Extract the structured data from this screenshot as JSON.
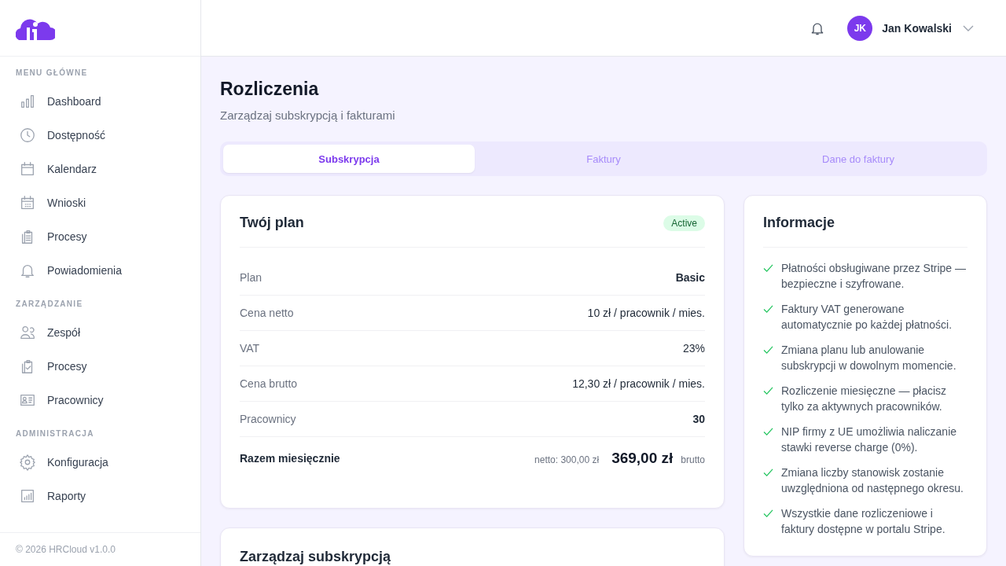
{
  "sidebar": {
    "sections": [
      {
        "title": "MENU GŁÓWNE",
        "items": [
          {
            "label": "Dashboard",
            "selected": false
          },
          {
            "label": "Dostępność",
            "selected": false
          },
          {
            "label": "Kalendarz",
            "selected": false
          },
          {
            "label": "Wnioski",
            "selected": false
          },
          {
            "label": "Procesy",
            "selected": false
          },
          {
            "label": "Powiadomienia",
            "selected": false
          }
        ]
      },
      {
        "title": "ZARZĄDZANIE",
        "items": [
          {
            "label": "Zespół",
            "selected": false
          },
          {
            "label": "Procesy",
            "selected": false
          },
          {
            "label": "Pracownicy",
            "selected": false
          }
        ]
      },
      {
        "title": "ADMINISTRACJA",
        "items": [
          {
            "label": "Konfiguracja",
            "selected": false
          },
          {
            "label": "Raporty",
            "selected": false
          }
        ]
      }
    ],
    "footer": "© 2026 HRCloud v1.0.0"
  },
  "header": {
    "user": {
      "initials": "JK",
      "name": "Jan Kowalski"
    }
  },
  "page": {
    "title": "Rozliczenia",
    "subtitle": "Zarządzaj subskrypcją i fakturami"
  },
  "tabs": [
    {
      "label": "Subskrypcja",
      "selected": true
    },
    {
      "label": "Faktury",
      "selected": false
    },
    {
      "label": "Dane do faktury",
      "selected": false
    }
  ],
  "plan_card": {
    "title": "Twój plan",
    "status": "Active",
    "rows": [
      {
        "label": "Plan",
        "value": "Basic",
        "emphasis": true
      },
      {
        "label": "Cena netto",
        "value": "10 zł / pracownik / mies.",
        "emphasis": false
      },
      {
        "label": "VAT",
        "value": "23%",
        "emphasis": false
      },
      {
        "label": "Cena brutto",
        "value": "12,30 zł / pracownik / mies.",
        "emphasis": false
      },
      {
        "label": "Pracownicy",
        "value": "30",
        "emphasis": true
      }
    ],
    "total": {
      "label": "Razem miesięcznie",
      "net": "netto: 300,00 zł",
      "amount": "369,00 zł",
      "suffix": "brutto"
    }
  },
  "manage_card": {
    "title": "Zarządzaj subskrypcją"
  },
  "info_card": {
    "title": "Informacje",
    "items": [
      "Płatności obsługiwane przez Stripe — bezpieczne i szyfrowane.",
      "Faktury VAT generowane automatycznie po każdej płatności.",
      "Zmiana planu lub anulowanie subskrypcji w dowolnym momencie.",
      "Rozliczenie miesięczne — płacisz tylko za aktywnych pracowników.",
      "NIP firmy z UE umożliwia naliczanie stawki reverse charge (0%).",
      "Zmiana liczby stanowisk zostanie uwzględniona od następnego okresu.",
      "Wszystkie dane rozliczeniowe i faktury dostępne w portalu Stripe."
    ]
  }
}
